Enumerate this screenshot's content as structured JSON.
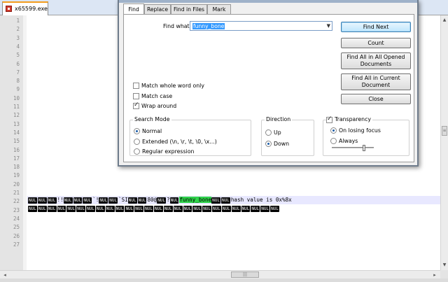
{
  "file_tab": {
    "label": "x65599.exe"
  },
  "gutter": {
    "line_numbers": [
      "1",
      "2",
      "3",
      "4",
      "5",
      "6",
      "7",
      "8",
      "9",
      "10",
      "11",
      "12",
      "13",
      "14",
      "15",
      "16",
      "17",
      "18",
      "19",
      "20",
      "21",
      "22",
      "23",
      "24",
      "25",
      "26",
      "27"
    ]
  },
  "editor": {
    "line21": {
      "tokens": [
        {
          "t": "nul",
          "v": "NUL"
        },
        {
          "t": "nul",
          "v": "NUL"
        },
        {
          "t": "nul",
          "v": "NUL"
        },
        {
          "t": "text",
          "v": "!!"
        },
        {
          "t": "nul",
          "v": "NUL"
        },
        {
          "t": "nul",
          "v": "NUL"
        },
        {
          "t": "nul",
          "v": "NUL"
        },
        {
          "t": "text",
          "v": "`!"
        },
        {
          "t": "nul",
          "v": "NUL"
        },
        {
          "t": "nul",
          "v": "NUL"
        },
        {
          "t": "text",
          "v": "`SI"
        },
        {
          "t": "nul",
          "v": "NUL"
        },
        {
          "t": "nul",
          "v": "NUL"
        },
        {
          "t": "text",
          "v": "80@"
        },
        {
          "t": "nul",
          "v": "NUL"
        },
        {
          "t": "text",
          "v": "?"
        },
        {
          "t": "nul",
          "v": "NUL"
        },
        {
          "t": "match",
          "v": "funny_bone"
        },
        {
          "t": "nul",
          "v": "NUL"
        },
        {
          "t": "nul",
          "v": "NUL"
        },
        {
          "t": "text",
          "v": "hash value is 0x%8x"
        }
      ]
    },
    "line22": {
      "nul_label": "NUL",
      "count": 26
    }
  },
  "dialog": {
    "tabs": [
      "Find",
      "Replace",
      "Find in Files",
      "Mark"
    ],
    "find_what_label": "Find what :",
    "find_what_value": "funny_bone",
    "buttons": {
      "find_next": "Find Next",
      "count": "Count",
      "find_all_opened": "Find All in All Opened Documents",
      "find_all_current": "Find All in Current Document",
      "close": "Close"
    },
    "options": {
      "match_whole_word": "Match whole word only",
      "match_case": "Match case",
      "wrap_around": "Wrap around"
    },
    "search_mode": {
      "title": "Search Mode",
      "normal": "Normal",
      "extended": "Extended (\\n, \\r, \\t, \\0, \\x...)",
      "regex": "Regular expression"
    },
    "direction": {
      "title": "Direction",
      "up": "Up",
      "down": "Down"
    },
    "transparency": {
      "title": "Transparency",
      "on_losing_focus": "On losing focus",
      "always": "Always"
    }
  }
}
